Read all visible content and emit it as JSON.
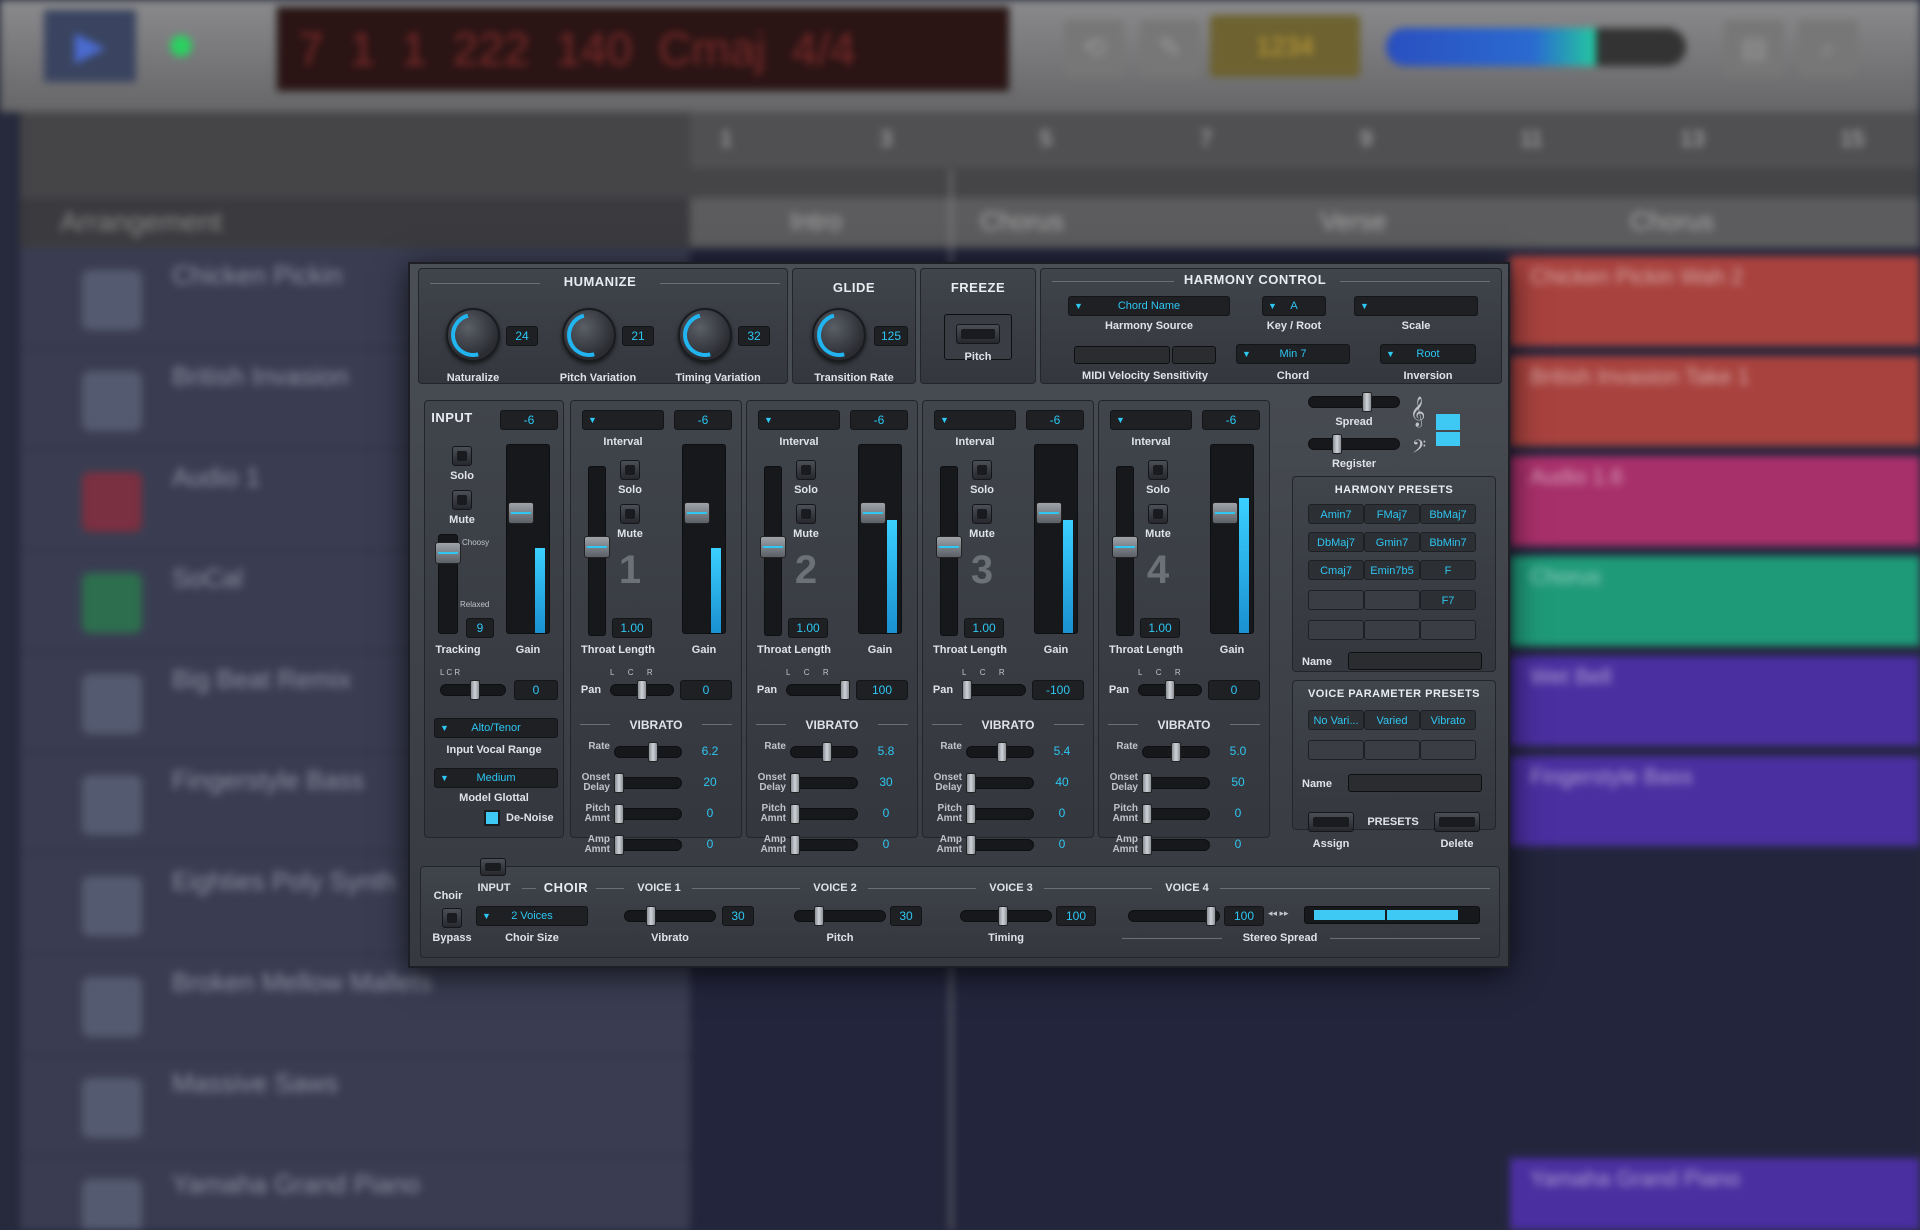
{
  "daw": {
    "lcd_text": [
      "7",
      "1",
      "1",
      "222",
      "140",
      "Cmaj",
      "4/4"
    ],
    "lcd_btn": "1234",
    "arrangement_label": "Arrangement",
    "ruler": [
      "1",
      "3",
      "5",
      "7",
      "9",
      "11",
      "13",
      "15"
    ],
    "sections": [
      "Intro",
      "Chorus",
      "Verse",
      "Chorus"
    ],
    "tracks": [
      "Chicken Pickin",
      "British Invasion",
      "Audio 1",
      "SoCal",
      "Big Beat Remix",
      "Fingerstyle Bass",
      "Eighties Poly Synth",
      "Broken Mellow Mallets",
      "Massive Saws",
      "Yamaha Grand Piano"
    ],
    "regions": [
      "Chicken Pickin Wah 2",
      "British Invasion Take 1",
      "Audio 1.6",
      "Chorus",
      "Wet Bell",
      "Fingerstyle Bass",
      "Yamaha Grand Piano"
    ]
  },
  "humanize": {
    "title": "HUMANIZE",
    "knobs": [
      {
        "label": "Naturalize",
        "value": "24"
      },
      {
        "label": "Pitch Variation",
        "value": "21"
      },
      {
        "label": "Timing Variation",
        "value": "32"
      }
    ]
  },
  "glide": {
    "title": "GLIDE",
    "label": "Transition Rate",
    "value": "125"
  },
  "freeze": {
    "title": "FREEZE",
    "label": "Pitch"
  },
  "harmony": {
    "title": "HARMONY CONTROL",
    "source": {
      "value": "Chord Name",
      "label": "Harmony Source"
    },
    "key": {
      "value": "A",
      "label": "Key / Root"
    },
    "scale": {
      "value": "",
      "label": "Scale"
    },
    "midi": {
      "label": "MIDI Velocity Sensitivity"
    },
    "chord": {
      "value": "Min 7",
      "label": "Chord"
    },
    "inversion": {
      "value": "Root",
      "label": "Inversion"
    },
    "spread_label": "Spread",
    "register_label": "Register",
    "presets_title": "HARMONY PRESETS",
    "presets": [
      "Amin7",
      "FMaj7",
      "BbMaj7",
      "DbMaj7",
      "Gmin7",
      "BbMin7",
      "Cmaj7",
      "Emin7b5",
      "F",
      "",
      "",
      "F7",
      "",
      "",
      ""
    ],
    "name_label": "Name"
  },
  "voice_presets": {
    "title": "VOICE PARAMETER PRESETS",
    "presets": [
      "No Vari...",
      "Varied",
      "Vibrato",
      "",
      "",
      ""
    ],
    "name_label": "Name",
    "presets_label": "PRESETS",
    "assign": "Assign",
    "delete": "Delete"
  },
  "input": {
    "title": "INPUT",
    "gain_value": "-6",
    "solo": "Solo",
    "mute": "Mute",
    "choosy": "Choosy",
    "relaxed": "Relaxed",
    "tracking_value": "9",
    "tracking_label": "Tracking",
    "gain_label": "Gain",
    "gain_level": 0.45,
    "pan_value": "0",
    "vocal_range": {
      "value": "Alto/Tenor",
      "label": "Input Vocal Range"
    },
    "glottal": {
      "value": "Medium",
      "label": "Model Glottal"
    },
    "denoise": "De-Noise"
  },
  "voices": [
    {
      "num": "1",
      "gain": "-6",
      "throat": "1.00",
      "pan": "0",
      "rate": "6.2",
      "onset": "20",
      "pitch": "0",
      "amp": "0",
      "level": 0.45
    },
    {
      "num": "2",
      "gain": "-6",
      "throat": "1.00",
      "pan": "100",
      "rate": "5.8",
      "onset": "30",
      "pitch": "0",
      "amp": "0",
      "level": 0.6
    },
    {
      "num": "3",
      "gain": "-6",
      "throat": "1.00",
      "pan": "-100",
      "rate": "5.4",
      "onset": "40",
      "pitch": "0",
      "amp": "0",
      "level": 0.6
    },
    {
      "num": "4",
      "gain": "-6",
      "throat": "1.00",
      "pan": "0",
      "rate": "5.0",
      "onset": "50",
      "pitch": "0",
      "amp": "0",
      "level": 0.72
    }
  ],
  "voice_labels": {
    "interval": "Interval",
    "solo": "Solo",
    "mute": "Mute",
    "throat": "Throat Length",
    "gain": "Gain",
    "pan": "Pan",
    "vibrato": "VIBRATO",
    "rate": "Rate",
    "onset": "Onset Delay",
    "pitch": "Pitch Amnt",
    "amp": "Amp Amnt"
  },
  "choir": {
    "title": "CHOIR",
    "choir_label": "Choir",
    "input_label": "INPUT",
    "voice_heads": [
      "VOICE 1",
      "VOICE 2",
      "VOICE 3",
      "VOICE 4"
    ],
    "bypass": "Bypass",
    "size": {
      "value": "2 Voices",
      "label": "Choir Size"
    },
    "vibrato": {
      "label": "Vibrato",
      "value": "30"
    },
    "pitch": {
      "label": "Pitch",
      "value": "30"
    },
    "timing": {
      "label": "Timing",
      "value": "100"
    },
    "stereo": {
      "label": "Stereo Spread",
      "value": "100"
    }
  }
}
